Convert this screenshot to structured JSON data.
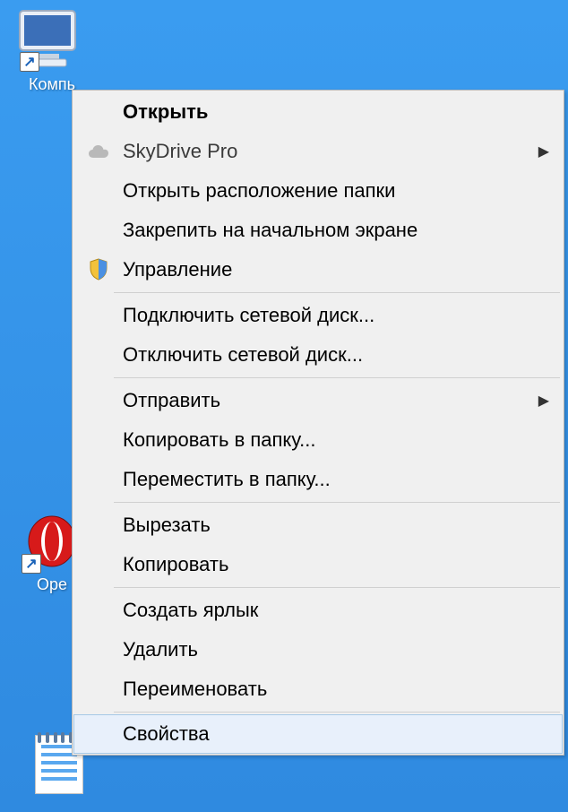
{
  "desktop": {
    "computer_label": "Компь",
    "opera_label": "Оре",
    "text_label": ""
  },
  "menu": {
    "open": "Открыть",
    "skydrive": "SkyDrive Pro",
    "open_location": "Открыть расположение папки",
    "pin_start": "Закрепить на начальном экране",
    "manage": "Управление",
    "map_drive": "Подключить сетевой диск...",
    "disconnect_drive": "Отключить сетевой диск...",
    "send_to": "Отправить",
    "copy_to_folder": "Копировать в папку...",
    "move_to_folder": "Переместить в папку...",
    "cut": "Вырезать",
    "copy": "Копировать",
    "create_shortcut": "Создать ярлык",
    "delete": "Удалить",
    "rename": "Переименовать",
    "properties": "Свойства"
  }
}
